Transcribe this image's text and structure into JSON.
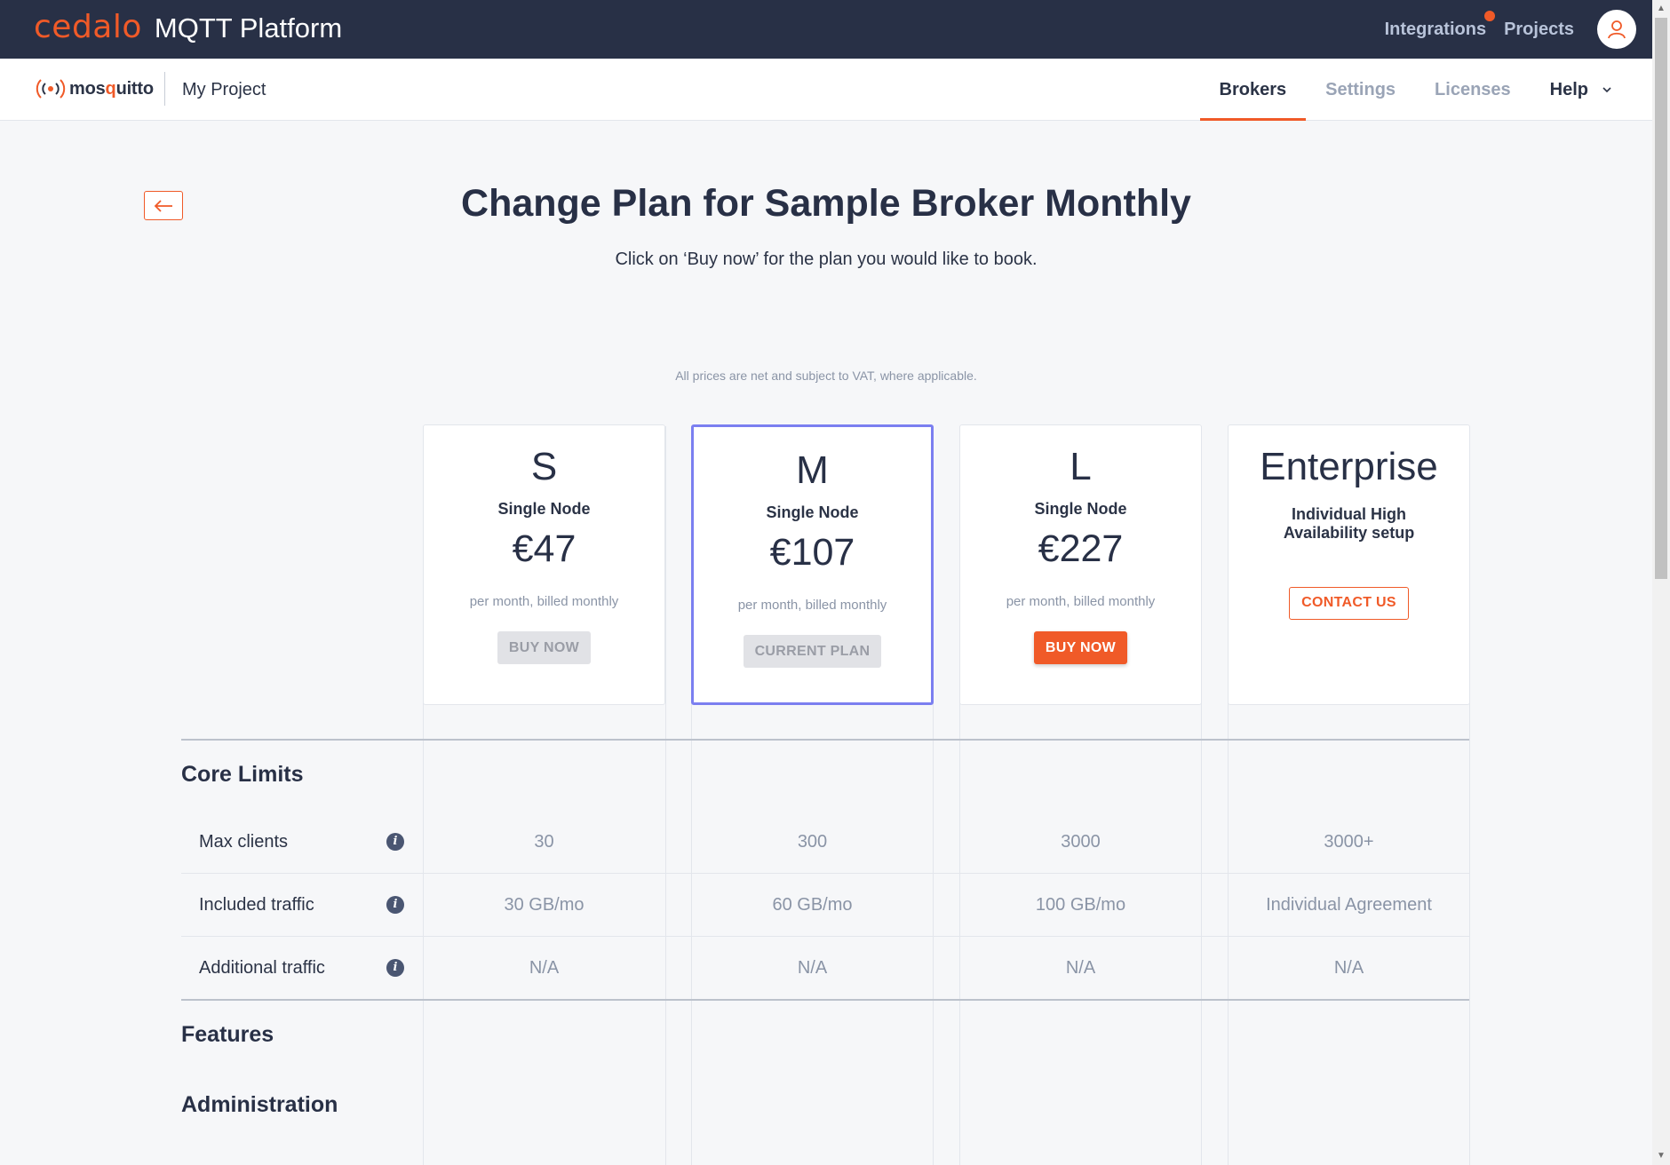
{
  "topbar": {
    "brand_logo": "cedalo",
    "brand_product": "MQTT Platform",
    "links": [
      "Integrations",
      "Projects"
    ],
    "avatar_icon": "user-icon"
  },
  "subnav": {
    "logo_text_a": "mos",
    "logo_text_q": "q",
    "logo_text_b": "uitto",
    "project": "My Project",
    "tabs": [
      "Brokers",
      "Settings",
      "Licenses",
      "Help"
    ],
    "active_tab": "Brokers"
  },
  "page": {
    "title": "Change Plan for Sample Broker Monthly",
    "subtitle": "Click on ‘Buy now’ for the plan you would like to book.",
    "vat_note": "All prices are net and subject to VAT, where applicable."
  },
  "plans": [
    {
      "name": "S",
      "sub": "Single Node",
      "price": "€47",
      "period": "per month, billed monthly",
      "button": "BUY NOW",
      "state": "disabled"
    },
    {
      "name": "M",
      "sub": "Single Node",
      "price": "€107",
      "period": "per month, billed monthly",
      "button": "CURRENT PLAN",
      "state": "current"
    },
    {
      "name": "L",
      "sub": "Single Node",
      "price": "€227",
      "period": "per month, billed monthly",
      "button": "BUY NOW",
      "state": "primary"
    },
    {
      "name": "Enterprise",
      "sub_line1": "Individual High",
      "sub_line2": "Availability setup",
      "button": "CONTACT US",
      "state": "outline"
    }
  ],
  "table": {
    "sections": [
      "Core Limits",
      "Features",
      "Administration"
    ],
    "rows": [
      {
        "label": "Max clients",
        "values": [
          "30",
          "300",
          "3000",
          "3000+"
        ]
      },
      {
        "label": "Included traffic",
        "values": [
          "30 GB/mo",
          "60 GB/mo",
          "100 GB/mo",
          "Individual Agreement"
        ]
      },
      {
        "label": "Additional traffic",
        "values": [
          "N/A",
          "N/A",
          "N/A",
          "N/A"
        ]
      }
    ]
  },
  "colors": {
    "accent": "#f05a28",
    "topbar_bg": "#283046",
    "current_plan_border": "#7b7ff0"
  }
}
